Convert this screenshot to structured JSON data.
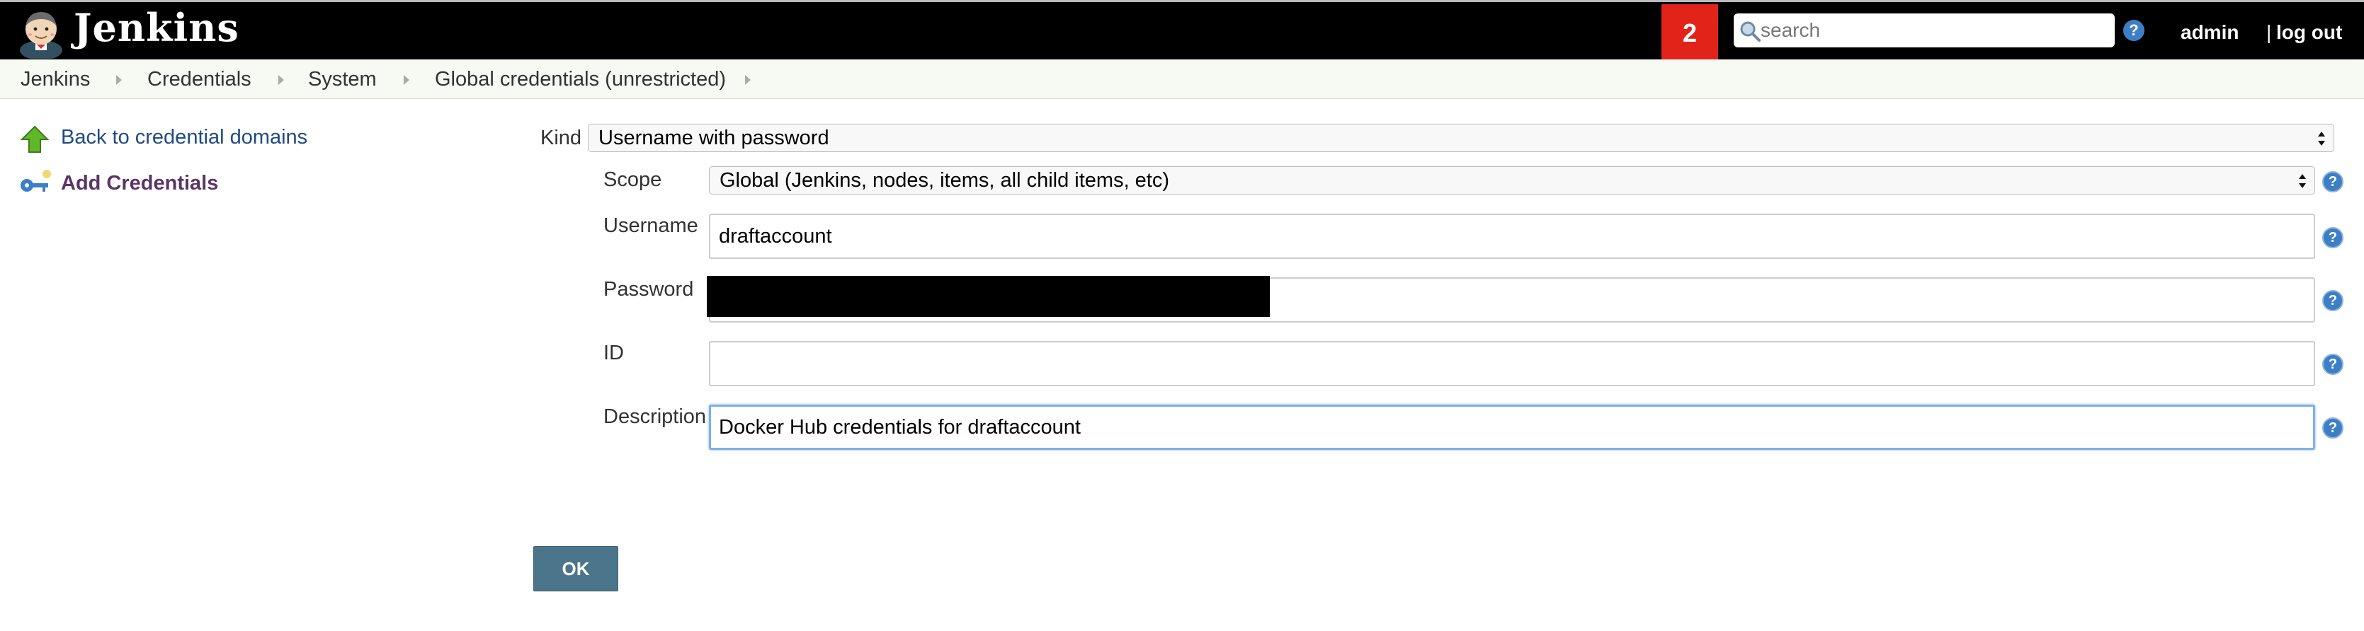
{
  "header": {
    "logo_text": "Jenkins",
    "notification_count": "2",
    "search_placeholder": "search",
    "help_symbol": "?",
    "user": "admin",
    "logout_separator": "|",
    "logout": "log out",
    "icons": {
      "logo": "jenkins-butler-icon",
      "search": "magnifier-icon",
      "help": "help-icon"
    }
  },
  "breadcrumb": {
    "items": [
      "Jenkins",
      "Credentials",
      "System",
      "Global credentials (unrestricted)"
    ]
  },
  "side_panel": {
    "back_label": "Back to credential domains",
    "add_label": "Add Credentials",
    "icons": {
      "back": "green-up-arrow-icon",
      "add": "key-icon"
    }
  },
  "form": {
    "kind": {
      "label": "Kind",
      "value": "Username with password"
    },
    "scope": {
      "label": "Scope",
      "value": "Global (Jenkins, nodes, items, all child items, etc)"
    },
    "username": {
      "label": "Username",
      "value": "draftaccount"
    },
    "password": {
      "label": "Password",
      "value": ""
    },
    "id": {
      "label": "ID",
      "value": ""
    },
    "description": {
      "label": "Description",
      "value": "Docker Hub credentials for draftaccount"
    },
    "help_symbol": "?",
    "ok_label": "OK"
  },
  "colors": {
    "header_bg": "#000000",
    "notification_bg": "#e2231a",
    "link": "#204a87",
    "button": "#4b758b",
    "help": "#3d7fc6"
  }
}
